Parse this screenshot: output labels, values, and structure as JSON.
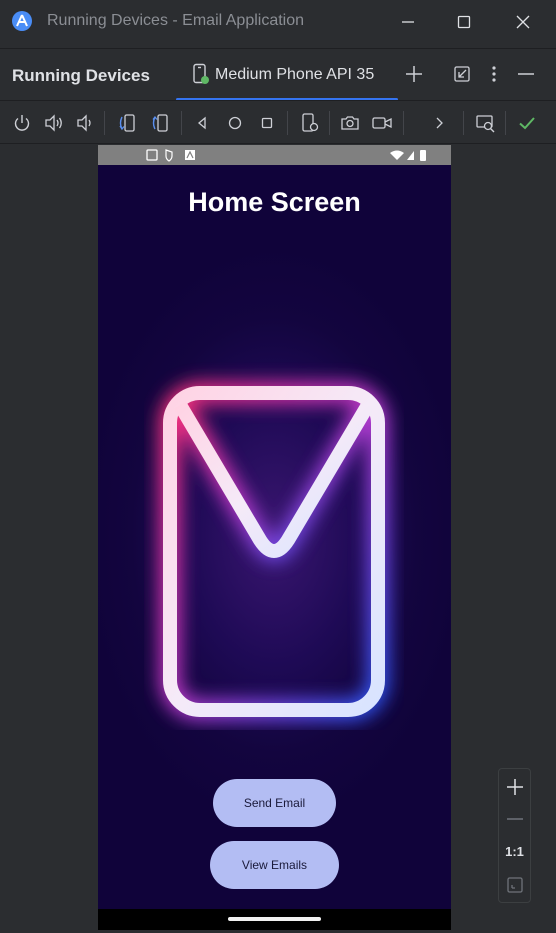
{
  "window": {
    "title": "Running Devices - Email Application",
    "logo_icon": "android-studio-icon",
    "controls": [
      "minimize-icon",
      "maximize-icon",
      "close-icon"
    ]
  },
  "tool_window": {
    "title": "Running Devices",
    "active_tab": "Medium Phone API 35",
    "accent": "#3574f0"
  },
  "toolbar": {
    "icons": [
      "power-icon",
      "volume-up-icon",
      "volume-down-icon",
      "rotate-left-icon",
      "rotate-right-icon",
      "back-icon",
      "home-icon",
      "overview-icon",
      "device-settings-icon",
      "screenshot-icon",
      "screen-record-icon",
      "more-icon",
      "device-mirroring-icon",
      "check-icon"
    ]
  },
  "device": {
    "screen_title": "Home Screen",
    "buttons": {
      "send": "Send Email",
      "view": "View Emails"
    },
    "button_color": "#b3bdf3",
    "background_color": "#10033a"
  },
  "zoom": {
    "one_to_one": "1:1"
  }
}
